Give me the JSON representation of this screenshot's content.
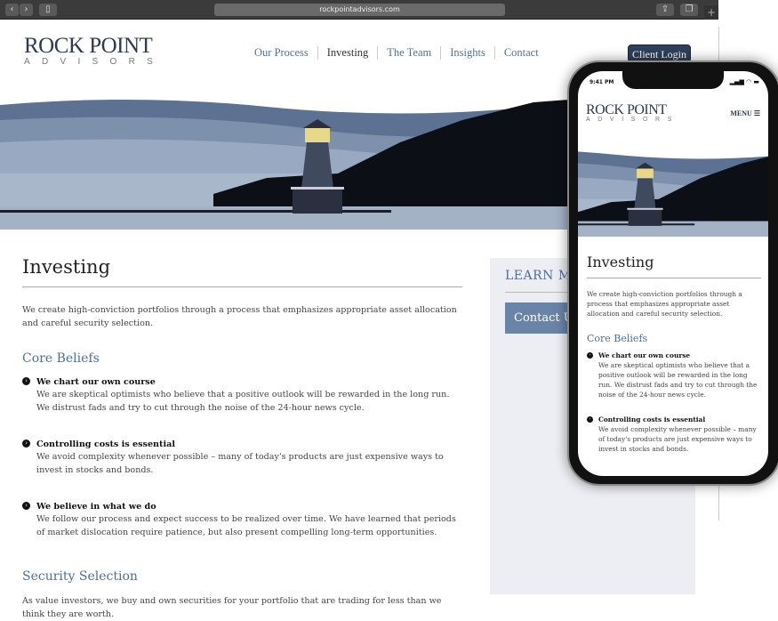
{
  "browser": {
    "url": "rockpointadvisors.com",
    "back": "‹",
    "forward": "›",
    "new_tab": "+"
  },
  "logo": {
    "line1": "ROCK POINT",
    "line2": "ADVISORS"
  },
  "nav": [
    {
      "label": "Our Process"
    },
    {
      "label": "Investing",
      "active": true
    },
    {
      "label": "The Team"
    },
    {
      "label": "Insights"
    },
    {
      "label": "Contact"
    }
  ],
  "client_login": "Client Login",
  "main": {
    "title": "Investing",
    "intro": "We create high-conviction portfolios through a process that emphasizes appropriate asset allocation and careful security selection.",
    "core_beliefs_heading": "Core Beliefs",
    "beliefs": [
      {
        "title": "We chart our own course",
        "text": "We are skeptical optimists who believe that a positive outlook will be rewarded in the long run. We distrust fads and try to cut through the noise of the 24-hour news cycle."
      },
      {
        "title": "Controlling costs is essential",
        "text": "We avoid complexity whenever possible – many of today's products are just expensive ways to invest in stocks and bonds."
      },
      {
        "title": "We believe in what we do",
        "text": "We follow our process and expect success to be realized over time. We have learned that periods of market dislocation require patience, but also present compelling long-term opportunities."
      }
    ],
    "security_heading": "Security Selection",
    "security_text": "As value investors, we buy and own securities for your portfolio that are trading for less than we think they are worth."
  },
  "sidebar": {
    "learn_more": "LEARN MORE",
    "contact_us": "Contact Us"
  },
  "phone": {
    "time": "9:41 PM",
    "status": "▂▄▆ ◠ ▬",
    "menu": "MENU ☰"
  },
  "colors": {
    "accent": "#4e6e9c",
    "button": "#2f405a",
    "sidebar_bg": "#eceef3"
  }
}
